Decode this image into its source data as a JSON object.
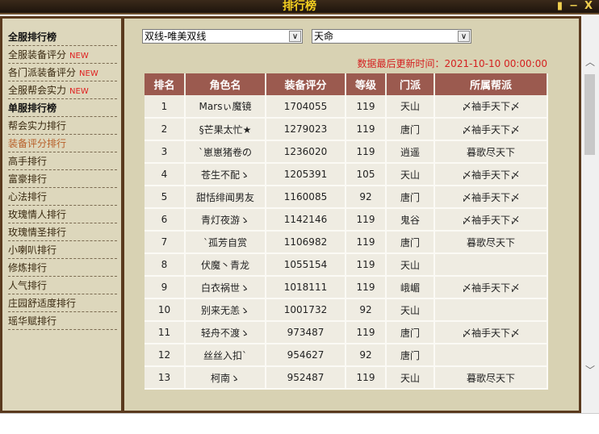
{
  "window": {
    "title": "排行榜",
    "controls": [
      "pin",
      "−",
      "X"
    ]
  },
  "sidebar": {
    "items": [
      {
        "label": "全服排行榜",
        "type": "head"
      },
      {
        "label": "全服装备评分",
        "new": "NEW"
      },
      {
        "label": "各门派装备评分",
        "new": "NEW"
      },
      {
        "label": "全服帮会实力",
        "new": "NEW"
      },
      {
        "label": "单服排行榜",
        "type": "head"
      },
      {
        "label": "帮会实力排行"
      },
      {
        "label": "装备评分排行",
        "type": "active"
      },
      {
        "label": "高手排行"
      },
      {
        "label": "富豪排行"
      },
      {
        "label": "心法排行"
      },
      {
        "label": "玫瑰情人排行"
      },
      {
        "label": "玫瑰情圣排行"
      },
      {
        "label": "小喇叭排行"
      },
      {
        "label": "修炼排行"
      },
      {
        "label": "人气排行"
      },
      {
        "label": "庄园舒适度排行"
      },
      {
        "label": "瑶华赋排行"
      }
    ]
  },
  "filters": {
    "region": "双线-唯美双线",
    "server": "天命"
  },
  "update_text": "数据最后更新时间：2021-10-10 00:00:00",
  "table": {
    "headers": [
      "排名",
      "角色名",
      "装备评分",
      "等级",
      "门派",
      "所属帮派"
    ],
    "rows": [
      [
        "1",
        "Marsぃ魔镜",
        "1704055",
        "119",
        "天山",
        "〆袖手天下〆"
      ],
      [
        "2",
        "§芒果太忙★",
        "1279023",
        "119",
        "唐门",
        "〆袖手天下〆"
      ],
      [
        "3",
        "`崽崽猪卷の",
        "1236020",
        "119",
        "逍遥",
        "暮歌尽天下"
      ],
      [
        "4",
        "苍生不配ゝ",
        "1205391",
        "105",
        "天山",
        "〆袖手天下〆"
      ],
      [
        "5",
        "甜恬绯闻男友",
        "1160085",
        "92",
        "唐门",
        "〆袖手天下〆"
      ],
      [
        "6",
        "青灯夜游ゝ",
        "1142146",
        "119",
        "鬼谷",
        "〆袖手天下〆"
      ],
      [
        "7",
        "`孤芳自赏",
        "1106982",
        "119",
        "唐门",
        "暮歌尽天下"
      ],
      [
        "8",
        "伏魔丶青龙",
        "1055154",
        "119",
        "天山",
        ""
      ],
      [
        "9",
        "白衣祸世ゝ",
        "1018111",
        "119",
        "峨嵋",
        "〆袖手天下〆"
      ],
      [
        "10",
        "别来无恙ゝ",
        "1001732",
        "92",
        "天山",
        ""
      ],
      [
        "11",
        "轻舟不渡ゝ",
        "973487",
        "119",
        "唐门",
        "〆袖手天下〆"
      ],
      [
        "12",
        "丝丝入扣`",
        "954627",
        "92",
        "唐门",
        ""
      ],
      [
        "13",
        "柯南ゝ",
        "952487",
        "119",
        "天山",
        "暮歌尽天下"
      ]
    ]
  }
}
